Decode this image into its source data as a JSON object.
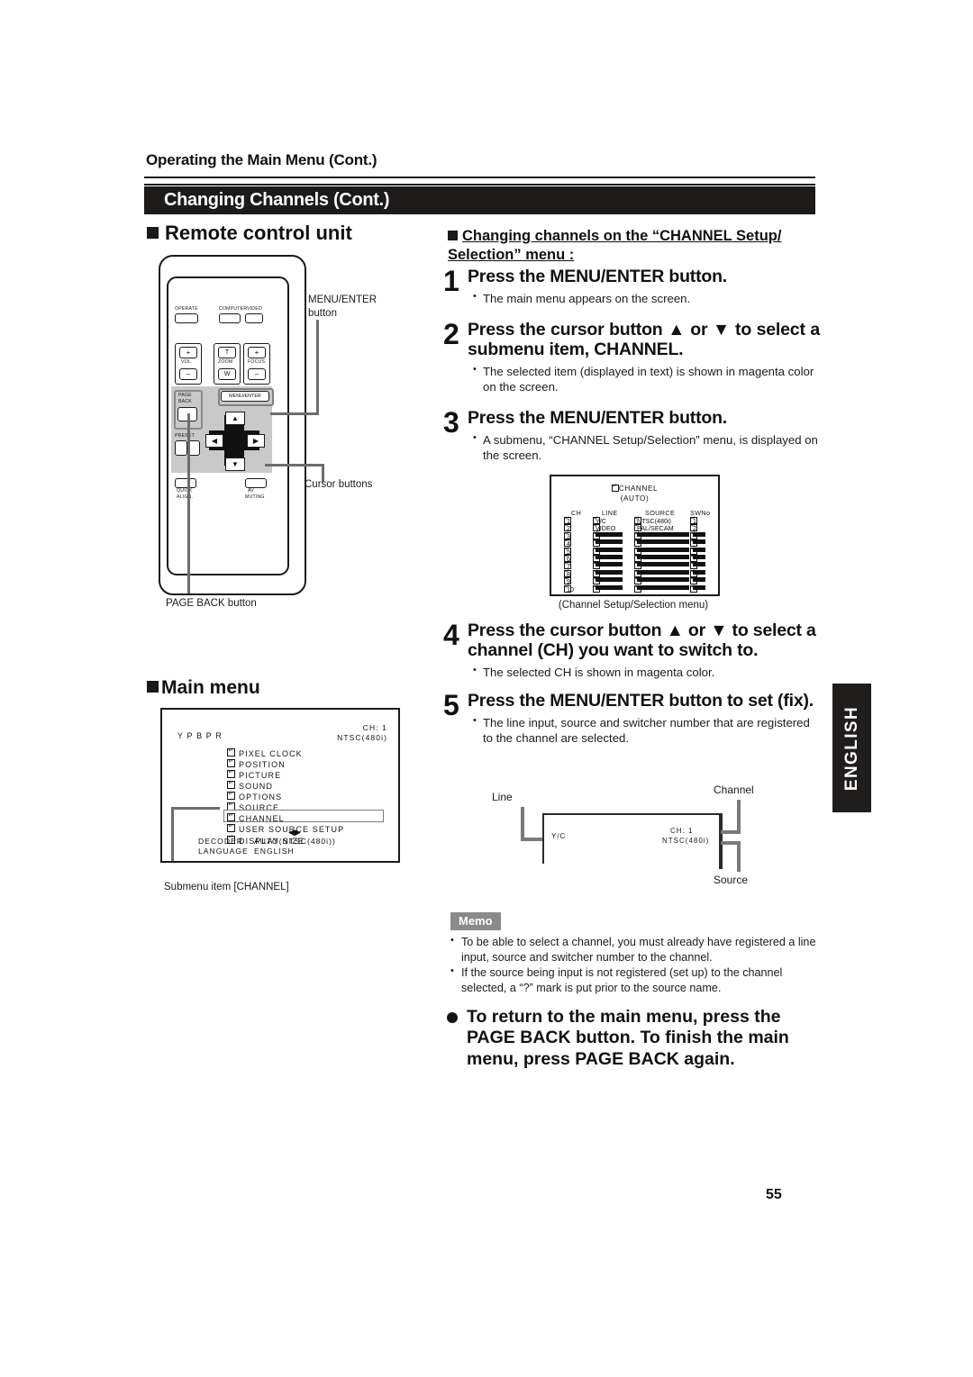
{
  "header": {
    "running_head": "Operating the Main Menu (Cont.)",
    "section_title": "Changing Channels (Cont.)"
  },
  "left_column": {
    "remote_heading": "Remote control unit",
    "mainmenu_heading": "Main menu",
    "callouts": {
      "menu_enter": "MENU/ENTER\nbutton",
      "menu_enter_line1": "MENU/ENTER",
      "menu_enter_line2": "button",
      "cursor_buttons": "Cursor buttons",
      "page_back": "PAGE BACK button",
      "submenu_item": "Submenu item [CHANNEL]"
    },
    "remote_buttons": {
      "operate": "OPERATE",
      "computer": "COMPUTER",
      "video": "VIDEO",
      "vol": "VOL.",
      "vol_plus": "+",
      "vol_minus": "–",
      "zoom": "ZOOM",
      "zoom_t": "T",
      "zoom_w": "W",
      "focus": "FOCUS",
      "focus_plus": "+",
      "focus_minus": "–",
      "menu_enter": "MENU/ENTER",
      "page_back_l1": "PAGE",
      "page_back_l2": "BACK",
      "preset": "PRESET",
      "quick_align_l1": "QUICK",
      "quick_align_l2": "ALIGN.",
      "av_muting_l1": "AV",
      "av_muting_l2": "MUTING",
      "cursor_up": "▲",
      "cursor_down": "▼",
      "cursor_left": "◀",
      "cursor_right": "▶"
    }
  },
  "main_menu_osd": {
    "source_label": "Y P B P R",
    "ch_line1": "CH:        1",
    "ch_line2": "NTSC(480i)",
    "items": [
      "PIXEL CLOCK",
      "POSITION",
      "PICTURE",
      "SOUND",
      "OPTIONS",
      "SOURCE",
      "CHANNEL",
      "USER SOURCE SETUP",
      "DISPLAY SIZE"
    ],
    "highlighted_item": "CHANNEL",
    "lr_arrows": "◀▶",
    "footer": [
      {
        "key": "DECODER",
        "value": "AUTO(NTSC(480i))"
      },
      {
        "key": "LANGUAGE",
        "value": "ENGLISH"
      }
    ]
  },
  "channel_osd": {
    "title": "CHANNEL",
    "subtitle": "(AUTO)",
    "caption": "(Channel Setup/Selection menu)",
    "columns": [
      "CH",
      "LINE",
      "SOURCE",
      "SWNo"
    ],
    "rows": [
      {
        "ch": "1",
        "line": "Y/C",
        "source": "NTSC(480i)",
        "sw": "1"
      },
      {
        "ch": "2",
        "line": "VIDEO",
        "source": "PAL/SECAM",
        "sw": "2"
      },
      {
        "ch": "3",
        "line": "",
        "source": "",
        "sw": ""
      },
      {
        "ch": "4",
        "line": "",
        "source": "",
        "sw": ""
      },
      {
        "ch": "5",
        "line": "",
        "source": "",
        "sw": ""
      },
      {
        "ch": "6",
        "line": "",
        "source": "",
        "sw": ""
      },
      {
        "ch": "7",
        "line": "",
        "source": "",
        "sw": ""
      },
      {
        "ch": "8",
        "line": "",
        "source": "",
        "sw": ""
      },
      {
        "ch": "9",
        "line": "",
        "source": "",
        "sw": ""
      },
      {
        "ch": "10",
        "line": "",
        "source": "",
        "sw": ""
      }
    ]
  },
  "right_column": {
    "subhead_line1": "Changing channels on the “CHANNEL Setup/",
    "subhead_line2": "Selection” menu :",
    "steps": [
      {
        "num": "1",
        "title": "Press the MENU/ENTER button.",
        "bullets": [
          "The main menu appears on the screen."
        ]
      },
      {
        "num": "2",
        "title": "Press the cursor button ▲ or ▼  to select a submenu item, CHANNEL.",
        "bullets": [
          "The selected item (displayed in text) is shown in magenta color on the screen."
        ]
      },
      {
        "num": "3",
        "title": "Press the MENU/ENTER button.",
        "bullets": [
          "A submenu, “CHANNEL Setup/Selection” menu, is displayed on the screen."
        ]
      },
      {
        "num": "4",
        "title": "Press the cursor button ▲ or ▼ to select a channel (CH) you want to switch to.",
        "bullets": [
          "The selected CH is shown in magenta color."
        ]
      },
      {
        "num": "5",
        "title": "Press the MENU/ENTER button to set (fix).",
        "bullets": [
          "The line input, source and switcher number that are registered to the channel  are selected."
        ]
      }
    ]
  },
  "diagram": {
    "label_line": "Line",
    "label_channel": "Channel",
    "label_source": "Source",
    "value_line": "Y/C",
    "value_ch": "CH:        1",
    "value_source": "NTSC(480i)"
  },
  "memo": {
    "tag": "Memo",
    "items": [
      "To be able to select a channel, you must already have registered a line input, source and switcher number to the channel.",
      "If the source being input is not registered (set up) to the channel selected, a “?” mark is put prior to the source name."
    ]
  },
  "final_note": "To return to the main menu, press the PAGE BACK button. To finish the main menu, press PAGE BACK again.",
  "side_tab": "ENGLISH",
  "page_number": "55"
}
